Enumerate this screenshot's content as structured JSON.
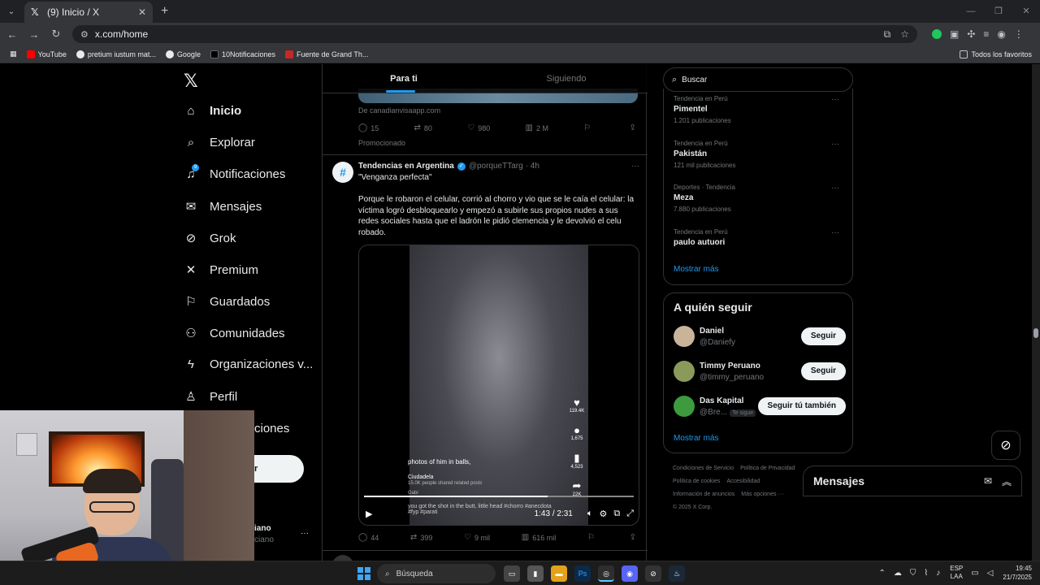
{
  "browser": {
    "tab_title": "(9) Inicio / X",
    "url": "x.com/home",
    "bookmarks": [
      "YouTube",
      "pretium iustum mat...",
      "Google",
      "10Notificaciones",
      "Fuente de Grand Th..."
    ],
    "bookmarks_right": "Todos los favoritos"
  },
  "nav": {
    "items": [
      {
        "label": "Inicio",
        "icon": "home-icon"
      },
      {
        "label": "Explorar",
        "icon": "search-icon"
      },
      {
        "label": "Notificaciones",
        "icon": "bell-icon",
        "badge": "9"
      },
      {
        "label": "Mensajes",
        "icon": "mail-icon"
      },
      {
        "label": "Grok",
        "icon": "grok-icon"
      },
      {
        "label": "Premium",
        "icon": "x-icon"
      },
      {
        "label": "Guardados",
        "icon": "bookmark-icon"
      },
      {
        "label": "Comunidades",
        "icon": "people-icon"
      },
      {
        "label": "Organizaciones v...",
        "icon": "bolt-icon"
      },
      {
        "label": "Perfil",
        "icon": "person-icon"
      }
    ],
    "covered_item": "ciones",
    "post_button_fragment": "r",
    "user_fragment": "iano",
    "user_handle_fragment": "ciano"
  },
  "feed": {
    "tabs": [
      "Para ti",
      "Siguiendo"
    ],
    "prev_post": {
      "from": "De canadianvisaapp.com",
      "replies": "15",
      "reposts": "80",
      "likes": "980",
      "views": "2 M",
      "promoted": "Promocionado"
    },
    "post": {
      "avatar": "#",
      "name": "Tendencias en Argentina",
      "handle": "@porqueTTarg",
      "time": "· 4h",
      "subtitle": "\"Venganza perfecta\"",
      "body": "Porque le robaron el celular, corrió al chorro y vio que se le caía el celular: la víctima logró desbloquearlo y empezó a subirle sus propios nudes a sus redes sociales hasta que el ladrón le pidió clemencia y le devolvió el celu robado.",
      "video": {
        "caption": "photos of him in balls,",
        "location": "Ciudadela",
        "location_sub": "15.0K people shared related posts",
        "user": "Gabi",
        "bottom": "you got the shot in the butt, little head #chorro #anecdota #fyp #parati",
        "likes": "119.4K",
        "comments": "1,675",
        "saves": "4,523",
        "shares": "22K",
        "progress": 0.68,
        "time": "1:43 / 2:31"
      },
      "replies": "44",
      "reposts": "399",
      "likes": "9 mil",
      "views": "616 mil"
    }
  },
  "right": {
    "search_placeholder": "Buscar",
    "trends": [
      {
        "context": "Tendencia en Perú",
        "name": "Pimentel",
        "posts": "1.201 publicaciones"
      },
      {
        "context": "Tendencia en Perú",
        "name": "Pakistán",
        "posts": "121 mil publicaciones"
      },
      {
        "context": "Deportes · Tendencia",
        "name": "Meza",
        "posts": "7.880 publicaciones"
      },
      {
        "context": "Tendencia en Perú",
        "name": "paulo autuori",
        "posts": ""
      }
    ],
    "show_more": "Mostrar más",
    "follow_title": "A quién seguir",
    "follow": [
      {
        "name": "Daniel",
        "handle": "@Daniefy",
        "button": "Seguir",
        "tag": ""
      },
      {
        "name": "Timmy Peruano",
        "handle": "@timmy_peruano",
        "button": "Seguir",
        "tag": ""
      },
      {
        "name": "Das Kapital",
        "handle": "@Bre...",
        "button": "Seguir tú también",
        "tag": "Te sigue"
      }
    ],
    "follow_more": "Mostrar más",
    "footer": [
      "Condiciones de Servicio",
      "Política de Privacidad",
      "Política de cookies",
      "Accesibilidad",
      "Información de anuncios",
      "Más opciones ···",
      "© 2025 X Corp."
    ]
  },
  "messages": {
    "title": "Mensajes"
  },
  "taskbar": {
    "search": "Búsqueda",
    "lang1": "ESP",
    "lang2": "LAA",
    "time": "19:45",
    "date": "21/7/2025"
  },
  "colors": {
    "accent": "#1d9bf0",
    "background": "#000000",
    "border": "#2f3336",
    "muted": "#71767b"
  }
}
